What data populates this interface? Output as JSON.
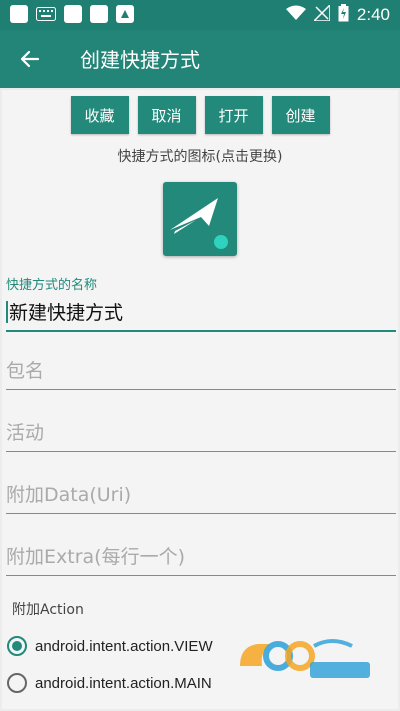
{
  "status_bar": {
    "time": "2:40"
  },
  "app_bar": {
    "title": "创建快捷方式"
  },
  "actions": {
    "collect": "收藏",
    "cancel": "取消",
    "open": "打开",
    "create": "创建"
  },
  "icon_hint": "快捷方式的图标(点击更换)",
  "fields": {
    "name_label": "快捷方式的名称",
    "name_value": "新建快捷方式",
    "package_placeholder": "包名",
    "activity_placeholder": "活动",
    "data_placeholder": "附加Data(Uri)",
    "extra_placeholder": "附加Extra(每行一个)"
  },
  "action_section": {
    "label": "附加Action",
    "options": [
      "android.intent.action.VIEW",
      "android.intent.action.MAIN"
    ],
    "selected": "android.intent.action.VIEW"
  },
  "colors": {
    "primary": "#238577",
    "accent": "#22897b",
    "status_bar": "#1f7f73"
  }
}
